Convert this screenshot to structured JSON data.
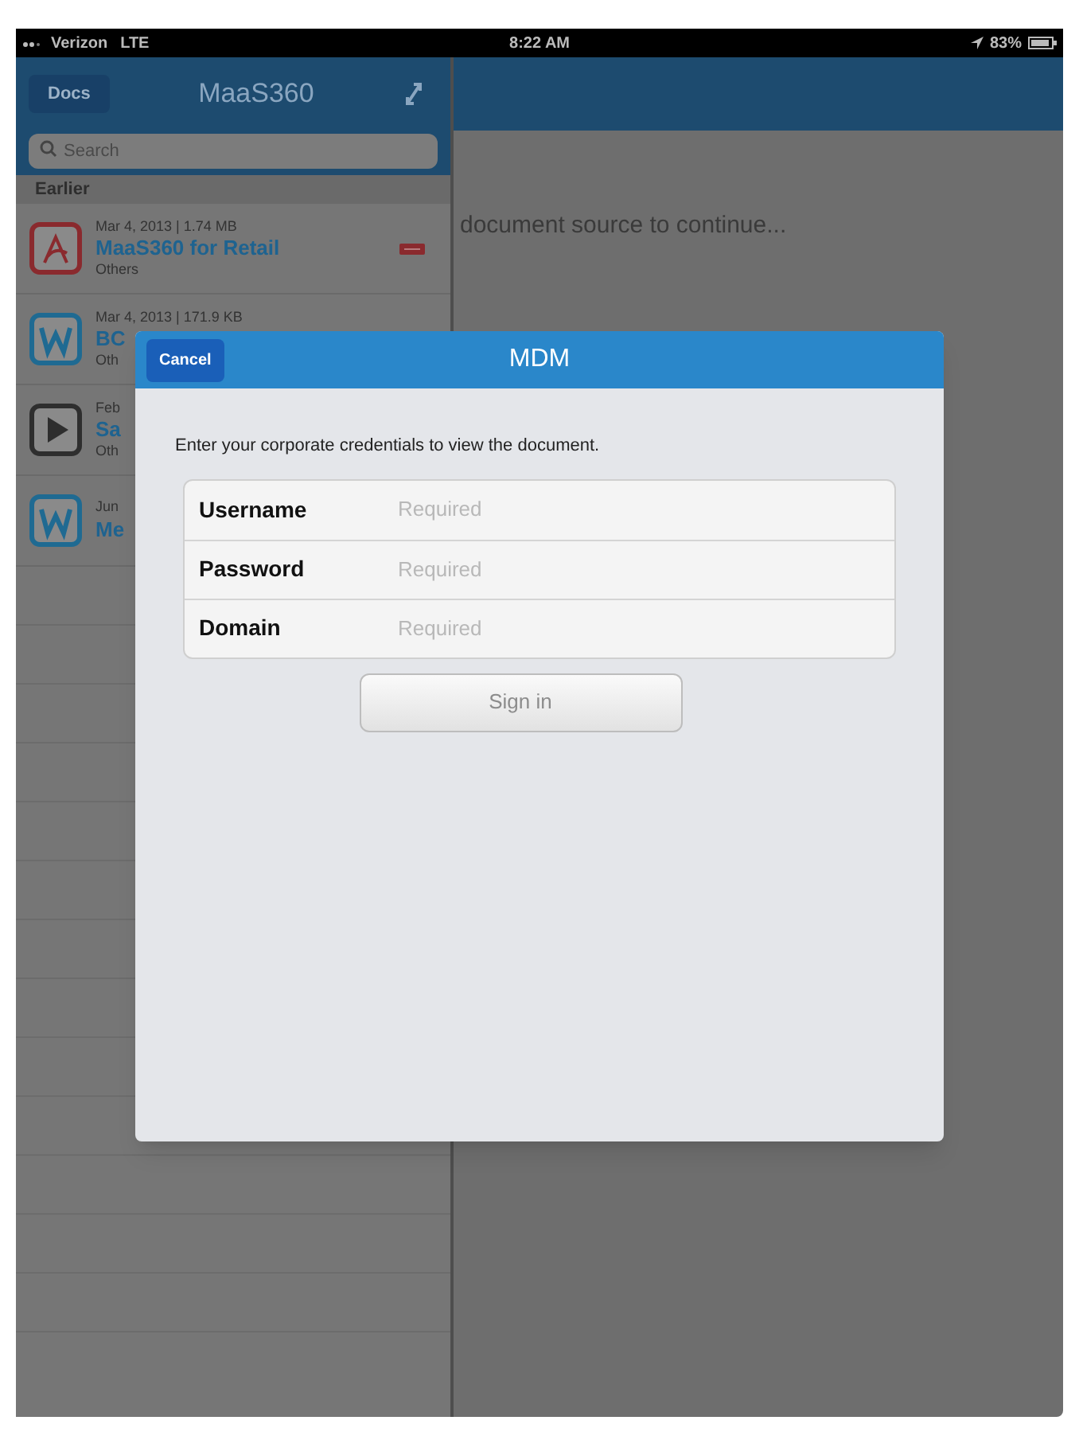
{
  "status_bar": {
    "carrier": "Verizon",
    "network": "LTE",
    "time": "8:22 AM",
    "battery": "83%"
  },
  "sidebar": {
    "back_button": "Docs",
    "title": "MaaS360",
    "search": {
      "placeholder": "Search"
    },
    "section": "Earlier",
    "items": [
      {
        "kind": "pdf",
        "meta": "Mar 4, 2013 | 1.74 MB",
        "title": "MaaS360 for Retail",
        "category": "Others",
        "is_new": true
      },
      {
        "kind": "word",
        "meta": "Mar 4, 2013 | 171.9 KB",
        "title": "BC",
        "category": "Oth",
        "is_new": false
      },
      {
        "kind": "video",
        "meta": "Feb",
        "title": "Sa",
        "category": "Oth",
        "is_new": false
      },
      {
        "kind": "word",
        "meta": "Jun",
        "title": "Me",
        "is_new": false
      }
    ]
  },
  "main": {
    "message": "document source to continue..."
  },
  "dialog": {
    "title": "MDM",
    "cancel": "Cancel",
    "instructions": "Enter your corporate credentials to view the document.",
    "fields": [
      {
        "label": "Username",
        "placeholder": "Required"
      },
      {
        "label": "Password",
        "placeholder": "Required"
      },
      {
        "label": "Domain",
        "placeholder": "Required"
      }
    ],
    "submit": {
      "label": "Sign in",
      "disabled": true
    }
  }
}
